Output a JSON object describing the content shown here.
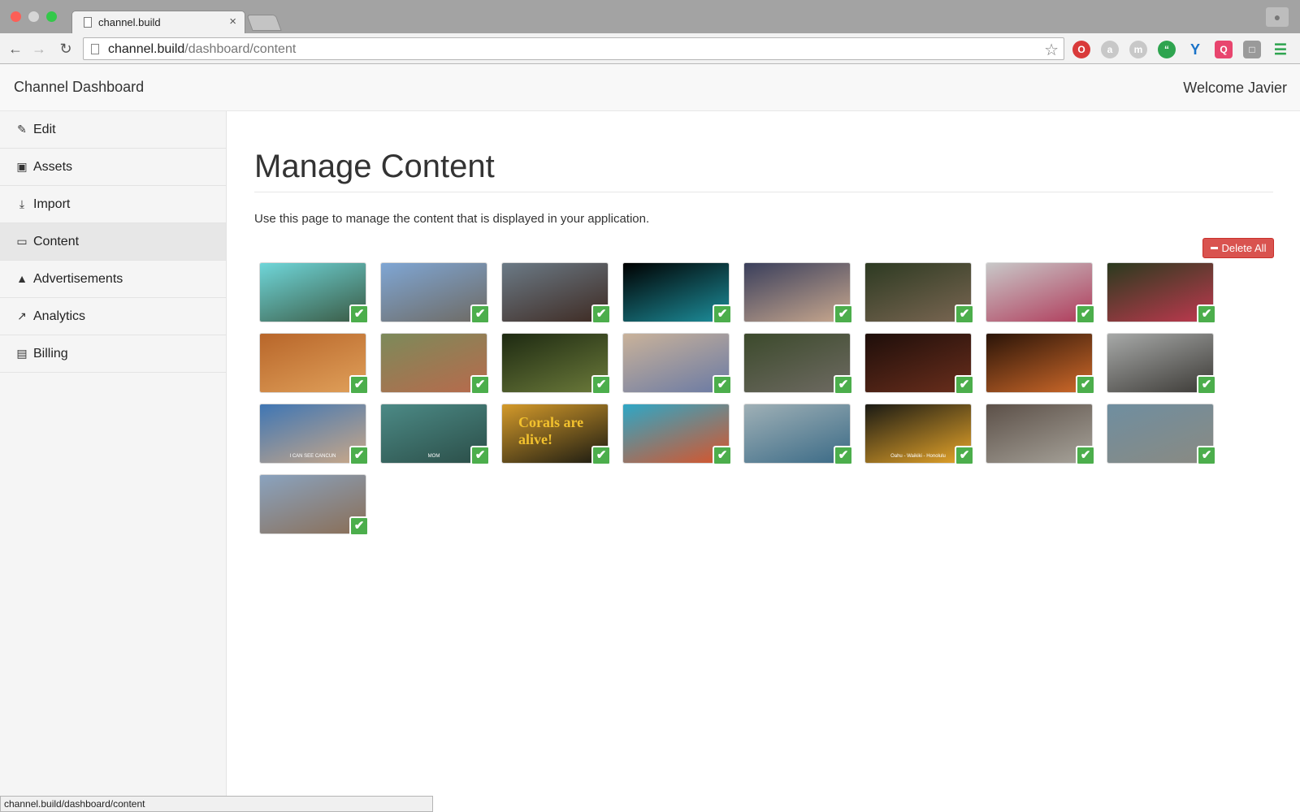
{
  "browser": {
    "tab_title": "channel.build",
    "url_host": "channel.build",
    "url_path": "/dashboard/content",
    "status_url": "channel.build/dashboard/content"
  },
  "navbar": {
    "brand": "Channel Dashboard",
    "welcome": "Welcome Javier"
  },
  "sidebar": {
    "items": [
      {
        "label": "Edit",
        "icon": "edit-icon",
        "active": false
      },
      {
        "label": "Assets",
        "icon": "image-icon",
        "active": false
      },
      {
        "label": "Import",
        "icon": "download-icon",
        "active": false
      },
      {
        "label": "Content",
        "icon": "desktop-icon",
        "active": true
      },
      {
        "label": "Advertisements",
        "icon": "bullhorn-icon",
        "active": false
      },
      {
        "label": "Analytics",
        "icon": "line-chart-icon",
        "active": false
      },
      {
        "label": "Billing",
        "icon": "credit-card-icon",
        "active": false
      }
    ]
  },
  "main": {
    "title": "Manage Content",
    "description": "Use this page to manage the content that is displayed in your application.",
    "delete_all_label": "Delete All"
  },
  "thumbnails": [
    {
      "selected": true,
      "colors": [
        "#6fd6d9",
        "#3a5a44"
      ],
      "caption": ""
    },
    {
      "selected": true,
      "colors": [
        "#7fa6d4",
        "#6e6a63"
      ],
      "caption": ""
    },
    {
      "selected": true,
      "colors": [
        "#6b7a86",
        "#3e2a22"
      ],
      "caption": ""
    },
    {
      "selected": true,
      "colors": [
        "#000000",
        "#1d8f9c"
      ],
      "caption": ""
    },
    {
      "selected": true,
      "colors": [
        "#3a3f5c",
        "#c9a88e"
      ],
      "caption": ""
    },
    {
      "selected": true,
      "colors": [
        "#2d3a22",
        "#7a6652"
      ],
      "caption": ""
    },
    {
      "selected": true,
      "colors": [
        "#c8c8c8",
        "#b03a5a"
      ],
      "caption": ""
    },
    {
      "selected": true,
      "colors": [
        "#2a3a1e",
        "#c0394f"
      ],
      "caption": ""
    },
    {
      "selected": true,
      "colors": [
        "#b8662a",
        "#e0a05a"
      ],
      "caption": ""
    },
    {
      "selected": true,
      "colors": [
        "#7c8a5a",
        "#b86a4c"
      ],
      "caption": ""
    },
    {
      "selected": true,
      "colors": [
        "#1e2a12",
        "#6b7a3a"
      ],
      "caption": ""
    },
    {
      "selected": true,
      "colors": [
        "#c9b29a",
        "#6a7aa4"
      ],
      "caption": ""
    },
    {
      "selected": true,
      "colors": [
        "#3c4a2c",
        "#6e6a62"
      ],
      "caption": ""
    },
    {
      "selected": true,
      "colors": [
        "#1e0e0a",
        "#6a2e1c"
      ],
      "caption": ""
    },
    {
      "selected": true,
      "colors": [
        "#2a1408",
        "#d06a2a"
      ],
      "caption": ""
    },
    {
      "selected": true,
      "colors": [
        "#a7a9a8",
        "#3c3a36"
      ],
      "caption": ""
    },
    {
      "selected": true,
      "colors": [
        "#3f76b4",
        "#caa888"
      ],
      "caption": "I CAN SEE CANCUN"
    },
    {
      "selected": true,
      "colors": [
        "#4c8a86",
        "#2b4e48"
      ],
      "caption": "MOM"
    },
    {
      "selected": true,
      "colors": [
        "#d49a2a",
        "#1a1a12"
      ],
      "caption": "Corals are alive!"
    },
    {
      "selected": true,
      "colors": [
        "#2ea7c6",
        "#d9542a"
      ],
      "caption": ""
    },
    {
      "selected": true,
      "colors": [
        "#9fb0b6",
        "#3a6a86"
      ],
      "caption": ""
    },
    {
      "selected": true,
      "colors": [
        "#1a1a14",
        "#e8a62a"
      ],
      "caption": "Oahu - Waikiki - Honolulu"
    },
    {
      "selected": true,
      "colors": [
        "#5c5048",
        "#a7a39a"
      ],
      "caption": ""
    },
    {
      "selected": true,
      "colors": [
        "#6f8ea0",
        "#8a8a82"
      ],
      "caption": ""
    },
    {
      "selected": true,
      "colors": [
        "#8aa3bf",
        "#8a6e56"
      ],
      "caption": ""
    }
  ]
}
